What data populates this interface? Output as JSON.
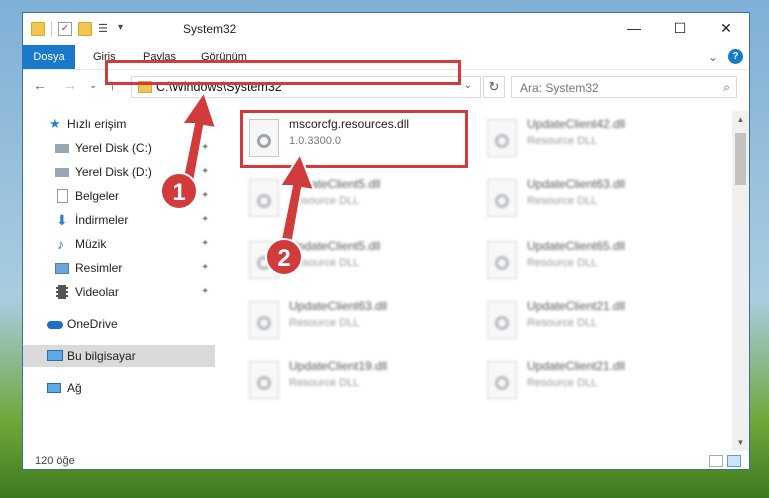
{
  "window": {
    "title": "System32",
    "controls": {
      "minimize": "—",
      "maximize": "☐",
      "close": "✕"
    }
  },
  "ribbon": {
    "tabs": [
      "Dosya",
      "Giriş",
      "Paylaş",
      "Görünüm"
    ],
    "expand_glyph": "⌄",
    "help_glyph": "?"
  },
  "address_bar": {
    "path": "C:\\Windows\\System32",
    "dropdown_glyph": "⌄",
    "refresh_glyph": "↻",
    "nav_glyphs": {
      "back": "←",
      "forward": "→",
      "recent": "⌄",
      "up": "↑"
    }
  },
  "search": {
    "placeholder": "Ara: System32",
    "icon_glyph": "⌕"
  },
  "sidebar": {
    "pin_glyph": "✦",
    "items": [
      {
        "label": "Hızlı erişim",
        "icon": "star-icon"
      },
      {
        "label": "Yerel Disk (C:)",
        "icon": "drive-icon"
      },
      {
        "label": "Yerel Disk (D:)",
        "icon": "drive-icon"
      },
      {
        "label": "Belgeler",
        "icon": "documents-icon"
      },
      {
        "label": "İndirmeler",
        "icon": "download-icon"
      },
      {
        "label": "Müzik",
        "icon": "music-icon"
      },
      {
        "label": "Resimler",
        "icon": "pictures-icon"
      },
      {
        "label": "Videolar",
        "icon": "video-icon"
      },
      {
        "label": "OneDrive",
        "icon": "cloud-icon"
      },
      {
        "label": "Bu bilgisayar",
        "icon": "computer-icon"
      },
      {
        "label": "Ağ",
        "icon": "network-icon"
      }
    ]
  },
  "files": {
    "highlighted": {
      "name": "mscorcfg.resources.dll",
      "type": "1.0.3300.0"
    },
    "col1": [
      {
        "name": "UpdateClient5.dll",
        "type": "Resource DLL"
      },
      {
        "name": "UpdateClient5.dll",
        "type": "Resource DLL"
      },
      {
        "name": "UpdateClient63.dll",
        "type": "Resource DLL"
      },
      {
        "name": "UpdateClient19.dll",
        "type": "Resource DLL"
      }
    ],
    "col2": [
      {
        "name": "UpdateClient42.dll",
        "type": "Resource DLL"
      },
      {
        "name": "UpdateClient63.dll",
        "type": "Resource DLL"
      },
      {
        "name": "UpdateClient65.dll",
        "type": "Resource DLL"
      },
      {
        "name": "UpdateClient21.dll",
        "type": "Resource DLL"
      },
      {
        "name": "UpdateClient21.dll",
        "type": "Resource DLL"
      }
    ]
  },
  "status": {
    "count": "120 öğe"
  },
  "annotations": {
    "step1": "1",
    "step2": "2",
    "color": "#d23b3b"
  },
  "scroll_glyphs": {
    "up": "▲",
    "down": "▼"
  }
}
